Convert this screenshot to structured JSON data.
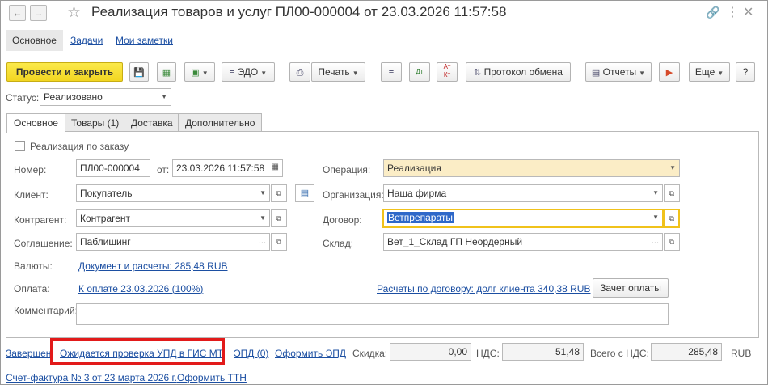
{
  "window": {
    "back_icon": "arrow-left-icon",
    "forward_icon": "arrow-right-icon",
    "star_icon": "star-icon",
    "title": "Реализация товаров и услуг ПЛ00-000004 от 23.03.2026 11:57:58",
    "link_icon": "link-icon",
    "more_icon": "more-icon",
    "close_icon": "close-icon"
  },
  "sections": {
    "main": "Основное",
    "tasks": "Задачи",
    "notes": "Мои заметки"
  },
  "toolbar": {
    "post_close": "Провести и закрыть",
    "edo": "ЭДО",
    "print": "Печать",
    "protocol": "Протокол обмена",
    "reports": "Отчеты",
    "more": "Еще",
    "help": "?",
    "dt_label": "Дт",
    "kt_label": "Кт",
    "at_label": "Ат"
  },
  "status": {
    "label": "Статус:",
    "value": "Реализовано"
  },
  "tabs": [
    "Основное",
    "Товары (1)",
    "Доставка",
    "Дополнительно"
  ],
  "form": {
    "by_order_label": "Реализация по заказу",
    "number_label": "Номер:",
    "number_value": "ПЛ00-000004",
    "date_label": "от:",
    "date_value": "23.03.2026 11:57:58",
    "client_label": "Клиент:",
    "client_value": "Покупатель",
    "counterparty_label": "Контрагент:",
    "counterparty_value": "Контрагент",
    "agreement_label": "Соглашение:",
    "agreement_value": "Паблишинг",
    "operation_label": "Операция:",
    "operation_value": "Реализация",
    "organization_label": "Организация:",
    "organization_value": "Наша фирма",
    "contract_label": "Договор:",
    "contract_value": "Ветпрепараты",
    "warehouse_label": "Склад:",
    "warehouse_value": "Вет_1_Склад ГП Неордерный",
    "currency_label": "Валюты:",
    "currency_link": "Документ и расчеты: 285,48 RUB",
    "payment_label": "Оплата:",
    "payment_link": "К оплате 23.03.2026 (100%)",
    "settlements_link": "Расчеты по договору: долг клиента 340,38 RUB",
    "offset_button": "Зачет оплаты",
    "comment_label": "Комментарий:",
    "comment_value": ""
  },
  "footer": {
    "completed_link": "Завершен",
    "gis_link": "Ожидается проверка УПД в ГИС МТ",
    "epd_link": "ЭПД (0)",
    "make_epd_link": "Оформить ЭПД",
    "discount_label": "Скидка:",
    "discount_value": "0,00",
    "vat_label": "НДС:",
    "vat_value": "51,48",
    "total_label": "Всего с НДС:",
    "total_value": "285,48",
    "currency": "RUB",
    "invoice_link": "Счет-фактура № 3 от 23 марта 2026 г.",
    "ttn_link": "Оформить ТТН"
  },
  "colors": {
    "primary_button": "#f2d622",
    "link": "#1c4fa2",
    "highlight_box": "#e21a1a",
    "operation_field": "#fbedc6",
    "focus_border": "#f0c21b",
    "selection": "#2e68c9"
  }
}
